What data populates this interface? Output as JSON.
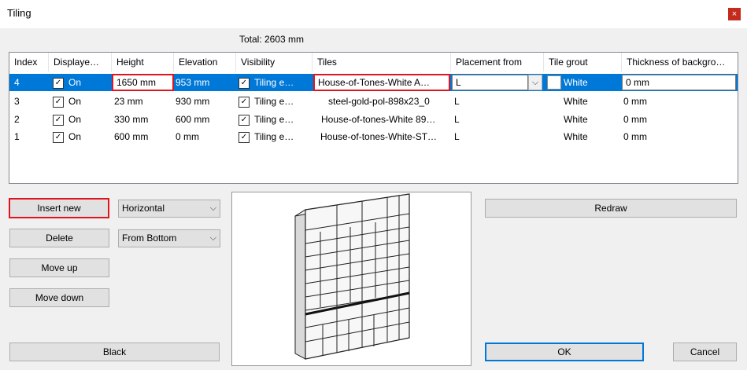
{
  "window": {
    "title": "Tiling",
    "close_glyph": "×"
  },
  "total_label": "Total: 2603 mm",
  "table": {
    "columns": [
      "Index",
      "Displaye…",
      "Height",
      "Elevation",
      "Visibility",
      "Tiles",
      "Placement from",
      "Tile grout",
      "Thickness of backgro…"
    ],
    "rows": [
      {
        "index": "4",
        "displayed": "On",
        "height": "1650 mm",
        "elevation": "953 mm",
        "visibility": "Tiling e…",
        "tiles": "House-of-Tones-White A…",
        "placement": "L",
        "grout": "White",
        "thickness": "0 mm"
      },
      {
        "index": "3",
        "displayed": "On",
        "height": "23 mm",
        "elevation": "930 mm",
        "visibility": "Tiling e…",
        "tiles": "steel-gold-pol-898x23_0",
        "placement": "L",
        "grout": "White",
        "thickness": "0 mm"
      },
      {
        "index": "2",
        "displayed": "On",
        "height": "330 mm",
        "elevation": "600 mm",
        "visibility": "Tiling e…",
        "tiles": "House-of-tones-White 89…",
        "placement": "L",
        "grout": "White",
        "thickness": "0 mm"
      },
      {
        "index": "1",
        "displayed": "On",
        "height": "600 mm",
        "elevation": "0 mm",
        "visibility": "Tiling e…",
        "tiles": "House-of-tones-White-ST…",
        "placement": "L",
        "grout": "White",
        "thickness": "0 mm"
      }
    ],
    "selected_row_index": 0
  },
  "buttons": {
    "insert_new": "Insert new",
    "delete": "Delete",
    "move_up": "Move up",
    "move_down": "Move down",
    "black": "Black",
    "redraw": "Redraw",
    "ok": "OK",
    "cancel": "Cancel"
  },
  "combos": {
    "orientation": "Horizontal",
    "start": "From Bottom"
  },
  "colors": {
    "selection": "#0078d7",
    "highlight": "#e0141e",
    "close": "#c42b1c"
  },
  "icons": {
    "checkbox": "✓",
    "dropdown": "⌵"
  }
}
